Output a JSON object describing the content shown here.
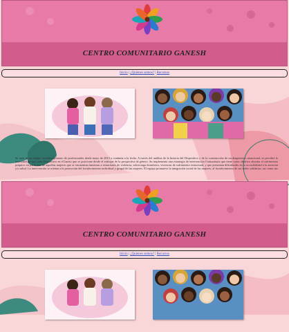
{
  "site": {
    "title": "CENTRO COMUNITARIO GANESH"
  },
  "nav": {
    "items": [
      "Inicio",
      "¿Quienes somos?",
      "Recursos"
    ],
    "separator": "|"
  },
  "about": {
    "text": "Se trata de un equipo multidisciplinario de profesionales desde mayo de 2013 a continúa a la fecha. A través del análisis de la historia del Dispositivo y de la construcción de un diagnóstico situacional, se percibió la necesidad de que cada Dispositivo en el barrio que se posicione desde el enfoque de la perspectiva de género. Su implementa una estrategia de intervención Comunitaria que tiene como objetivo abordar el sufrimiento psíquico en particular de aquellas mujeres que se encuentran inmersas a situaciones de violencia, sobrecarga doméstica, vivencias de sufrimiento estructural, y que presentan dificultades en la accesibilidad a la atención y/o salud. La intervención se orienta a la promoción del fortalecimiento individual y grupal de las mujeres. El equipo promueve la integración social de las mujeres, al fortalecimiento de sus redes solidarias, así como sus habilidades psicosociales, mejorando de esta manera su calidad de vida y la de la comunidad. Se"
  },
  "colors": {
    "header": "#e77aa6",
    "header_band": "#d25c8c",
    "background": "#f9d6d8",
    "link": "#3050c0"
  },
  "images": {
    "first": "women-embracing-illustration",
    "second": "diverse-women-faces-illustration"
  }
}
